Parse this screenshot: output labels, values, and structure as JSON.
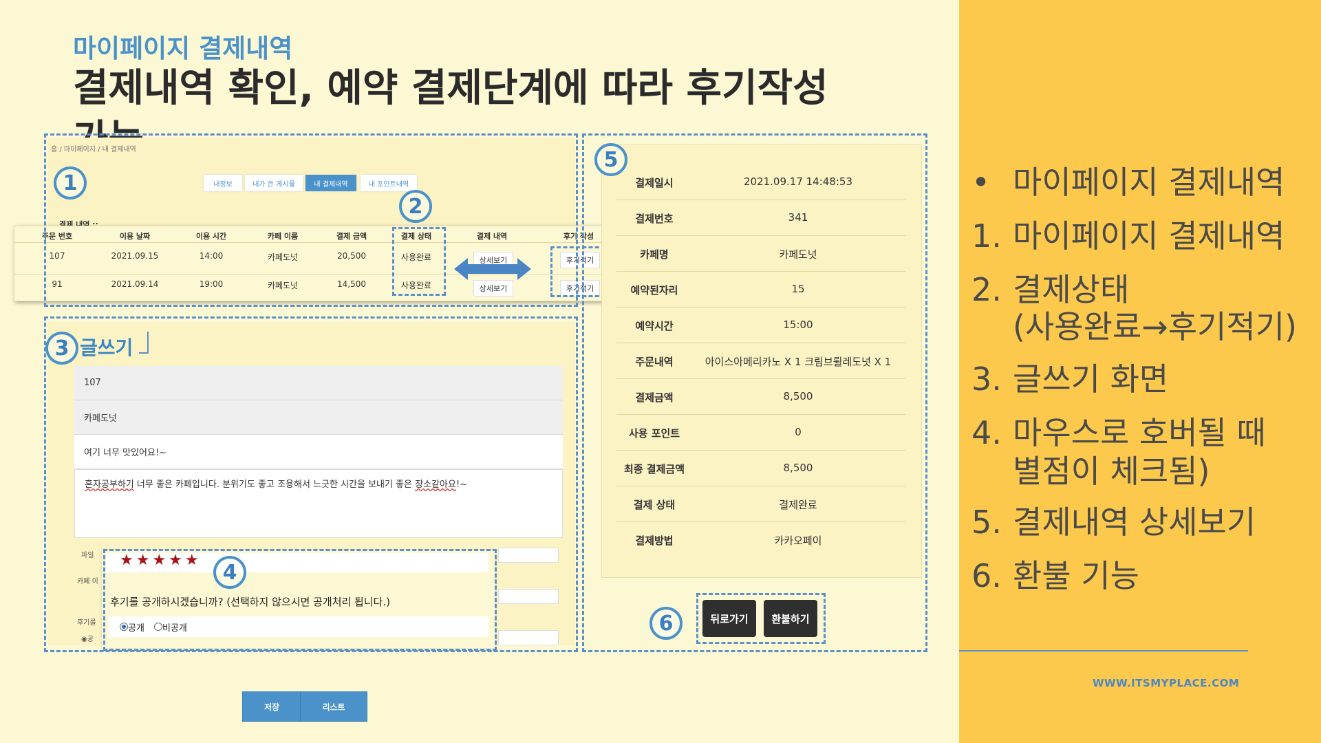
{
  "slide": {
    "subtitle": "마이페이지 결제내역",
    "title": "결제내역 확인, 예약 결제단계에 따라 후기작성 가능",
    "site_url": "WWW.ITSMYPLACE.COM"
  },
  "side_list": [
    {
      "num": "•",
      "text": "마이페이지 결제내역"
    },
    {
      "num": "1.",
      "text": "마이페이지 결제내역"
    },
    {
      "num": "2.",
      "text": "결제상태"
    },
    {
      "num": "",
      "text": "(사용완료→후기적기)"
    },
    {
      "num": "3.",
      "text": "글쓰기 화면"
    },
    {
      "num": "4.",
      "text": "마우스로 호버될 때"
    },
    {
      "num": "",
      "text": "별점이 체크됨)"
    },
    {
      "num": "5.",
      "text": "결제내역 상세보기"
    },
    {
      "num": "6.",
      "text": "환불 기능"
    }
  ],
  "markers": [
    "1",
    "2",
    "3",
    "4",
    "5",
    "6"
  ],
  "mypage": {
    "breadcrumb": "홈  /  마이페이지  /  내 결제내역",
    "tabs": [
      "내정보",
      "내가 쓴 게시물",
      "내 결제내역",
      "내 포인트내역"
    ],
    "active_tab": 2,
    "section_label": "결제 내역 ::",
    "table": {
      "headers": [
        "주문 번호",
        "이용 날짜",
        "이용 시간",
        "카페 이름",
        "결제 금액",
        "결제 상태",
        "결제 내역",
        "후기 작성"
      ],
      "rows": [
        {
          "order": "107",
          "date": "2021.09.15",
          "time": "14:00",
          "cafe": "카페도넛",
          "amount": "20,500",
          "status": "사용완료",
          "detail": "상세보기",
          "review": "후기적기"
        },
        {
          "order": "91",
          "date": "2021.09.14",
          "time": "19:00",
          "cafe": "카페도넛",
          "amount": "14,500",
          "status": "사용완료",
          "detail": "상세보기",
          "review": "후기적기"
        }
      ]
    }
  },
  "write": {
    "title": "글쓰기",
    "order_no": "107",
    "cafe_name": "카페도넛",
    "review_title": "여기 너무 맛있어요!~",
    "content_squiggle_1": "혼자공부하기",
    "content_mid": " 너무 좋은 카페입니다. 분위기도 좋고 조용해서 느긋한 시간을 보내기 좋은 ",
    "content_squiggle_2": "장소같아요",
    "content_end": "!~",
    "stub_labels": [
      "파일",
      "카페 이",
      "후기를",
      "◉공"
    ],
    "save_label": "저장",
    "list_label": "리스트"
  },
  "popup": {
    "stars": "★★★★★",
    "rating": 5,
    "question": "후기를 공개하시겠습니까? (선택하지 않으시면 공개처리 됩니다.)",
    "option_public": "공개",
    "option_private": "비공개"
  },
  "detail": {
    "rows": [
      {
        "label": "결제일시",
        "value": "2021.09.17 14:48:53"
      },
      {
        "label": "결제번호",
        "value": "341"
      },
      {
        "label": "카페명",
        "value": "카페도넛"
      },
      {
        "label": "예약된자리",
        "value": "15"
      },
      {
        "label": "예약시간",
        "value": "15:00"
      },
      {
        "label": "주문내역",
        "value": "아이스아메리카노 X 1  크림브륄레도넛 X 1"
      },
      {
        "label": "결제금액",
        "value": "8,500"
      },
      {
        "label": "사용 포인트",
        "value": "0"
      },
      {
        "label": "최종 결제금액",
        "value": "8,500"
      },
      {
        "label": "결제 상태",
        "value": "결제완료"
      },
      {
        "label": "결제방법",
        "value": "카카오페이"
      }
    ],
    "back_label": "뒤로가기",
    "refund_label": "환불하기"
  },
  "colors": {
    "accent_blue": "#4a92c9",
    "panel_yellow": "#fcc94c",
    "background": "#fdf8d4",
    "star_red": "#a8141b"
  }
}
